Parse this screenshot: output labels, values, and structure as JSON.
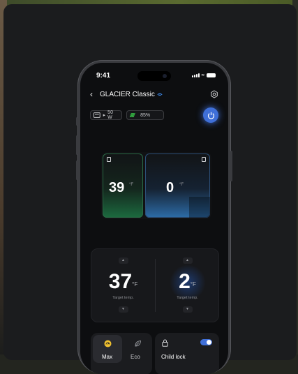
{
  "status": {
    "time": "9:41"
  },
  "device": {
    "name": "GLACIER Classic"
  },
  "chips": {
    "input_power": "50 W",
    "battery": "85%"
  },
  "zones": {
    "left": {
      "temp": "39",
      "unit": "°F"
    },
    "right": {
      "temp": "0",
      "unit": "°F"
    }
  },
  "controls": {
    "left": {
      "temp": "37",
      "unit": "°F",
      "caption": "Target temp."
    },
    "right": {
      "temp": "2",
      "unit": "°F",
      "caption": "Target temp."
    }
  },
  "modes": {
    "items": [
      {
        "label": "Max",
        "selected": true
      },
      {
        "label": "Eco",
        "selected": false
      }
    ]
  },
  "child_lock": {
    "label": "Child lock",
    "enabled": true
  },
  "colors": {
    "accent": "#3f6fd8",
    "battery_green": "#39c349",
    "left_zone": "#1c6a3f",
    "right_zone": "#2d6ca8",
    "max_icon": "#f2c230"
  }
}
